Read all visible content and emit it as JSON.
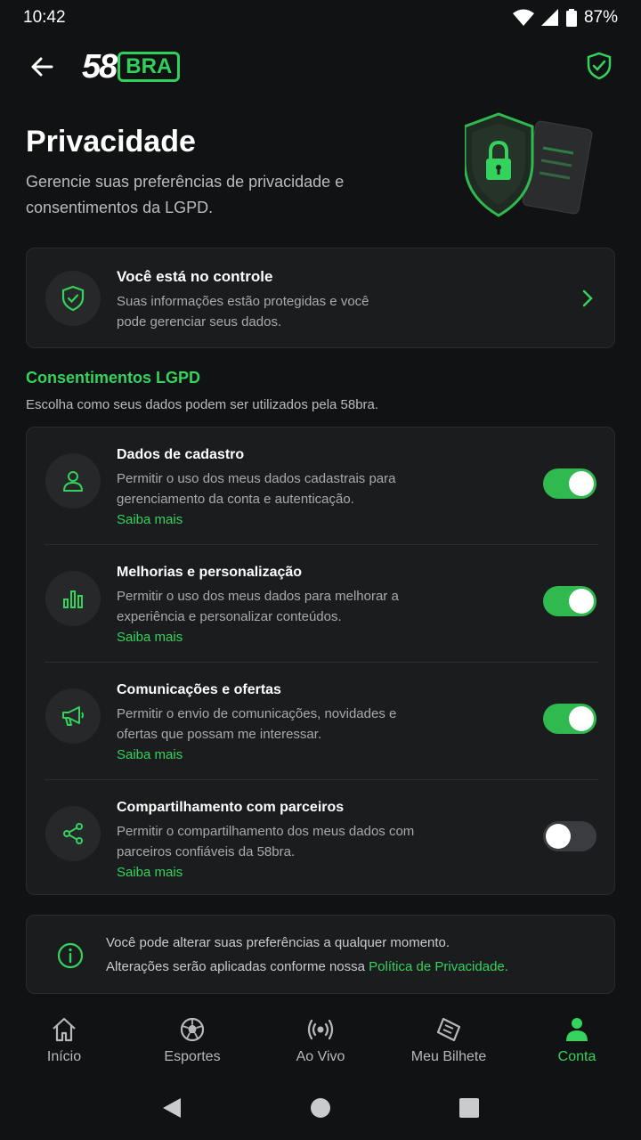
{
  "status_bar": {
    "time": "10:42",
    "battery": "87%"
  },
  "app_bar": {
    "logo_number": "58",
    "logo_suffix": "BRA"
  },
  "hero": {
    "title": "Privacidade",
    "subtitle": "Gerencie suas preferências de privacidade e consentimentos da LGPD."
  },
  "control_card": {
    "title": "Você está no controle",
    "description": "Suas informações estão protegidas e você pode gerenciar seus dados."
  },
  "consents": {
    "section_title": "Consentimentos LGPD",
    "section_description": "Escolha como seus dados podem ser utilizados pela 58bra.",
    "items": [
      {
        "icon": "user-icon",
        "title": "Dados de cadastro",
        "description": "Permitir o uso dos meus dados cadastrais para gerenciamento da conta e autenticação.",
        "link": "Saiba mais",
        "enabled": true
      },
      {
        "icon": "bar-chart-icon",
        "title": "Melhorias e personalização",
        "description": "Permitir o uso dos meus dados para melhorar a experiência e personalizar conteúdos.",
        "link": "Saiba mais",
        "enabled": true
      },
      {
        "icon": "megaphone-icon",
        "title": "Comunicações e ofertas",
        "description": "Permitir o envio de comunicações, novidades e ofertas que possam me interessar.",
        "link": "Saiba mais",
        "enabled": true
      },
      {
        "icon": "share-icon",
        "title": "Compartilhamento com parceiros",
        "description": "Permitir o compartilhamento dos meus dados com parceiros confiáveis da 58bra.",
        "link": "Saiba mais",
        "enabled": false
      }
    ]
  },
  "info": {
    "line1": "Você pode alterar suas preferências a qualquer momento.",
    "line2_prefix": "Alterações serão aplicadas conforme nossa ",
    "line2_link": "Política de Privacidade."
  },
  "bottom_nav": {
    "items": [
      {
        "label": "Início",
        "icon": "home-icon",
        "active": false
      },
      {
        "label": "Esportes",
        "icon": "soccer-ball-icon",
        "active": false
      },
      {
        "label": "Ao Vivo",
        "icon": "live-broadcast-icon",
        "active": false
      },
      {
        "label": "Meu Bilhete",
        "icon": "ticket-icon",
        "active": false
      },
      {
        "label": "Conta",
        "icon": "account-icon",
        "active": true
      }
    ]
  },
  "colors": {
    "accent": "#35d25d",
    "background": "#111213",
    "card": "#1b1c1e",
    "toggle_on": "#2fb94f",
    "toggle_off": "#3a3c3f"
  }
}
